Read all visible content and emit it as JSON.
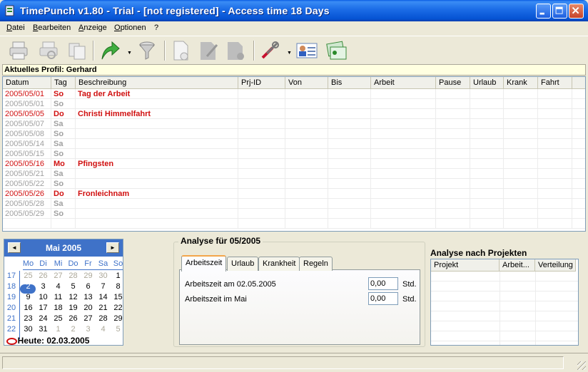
{
  "window": {
    "title": "TimePunch v1.80 - Trial - [not registered] - Access time 18 Days"
  },
  "menu": [
    "Datei",
    "Bearbeiten",
    "Anzeige",
    "Optionen",
    "?"
  ],
  "toolbar": {
    "buttons": [
      "print-icon",
      "print-preview-icon",
      "copy-icon",
      "export-arrow-icon",
      "filter-funnel-icon",
      "new-document-icon",
      "edit-document-icon",
      "delete-document-icon",
      "settings-tools-icon",
      "user-profile-icon",
      "project-card-icon"
    ]
  },
  "profile": {
    "label": "Aktuelles Profil: Gerhard"
  },
  "grid": {
    "columns": [
      "Datum",
      "Tag",
      "Beschreibung",
      "Prj-ID",
      "Von",
      "Bis",
      "Arbeit",
      "Pause",
      "Urlaub",
      "Krank",
      "Fahrt"
    ],
    "rows": [
      {
        "date": "2005/05/01",
        "day": "So",
        "desc": "Tag der Arbeit",
        "holiday": true
      },
      {
        "date": "2005/05/01",
        "day": "So",
        "desc": "",
        "holiday": false
      },
      {
        "date": "2005/05/05",
        "day": "Do",
        "desc": "Christi Himmelfahrt",
        "holiday": true
      },
      {
        "date": "2005/05/07",
        "day": "Sa",
        "desc": "",
        "holiday": false
      },
      {
        "date": "2005/05/08",
        "day": "So",
        "desc": "",
        "holiday": false
      },
      {
        "date": "2005/05/14",
        "day": "Sa",
        "desc": "",
        "holiday": false
      },
      {
        "date": "2005/05/15",
        "day": "So",
        "desc": "",
        "holiday": false
      },
      {
        "date": "2005/05/16",
        "day": "Mo",
        "desc": "Pfingsten",
        "holiday": true
      },
      {
        "date": "2005/05/21",
        "day": "Sa",
        "desc": "",
        "holiday": false
      },
      {
        "date": "2005/05/22",
        "day": "So",
        "desc": "",
        "holiday": false
      },
      {
        "date": "2005/05/26",
        "day": "Do",
        "desc": "Fronleichnam",
        "holiday": true
      },
      {
        "date": "2005/05/28",
        "day": "Sa",
        "desc": "",
        "holiday": false
      },
      {
        "date": "2005/05/29",
        "day": "So",
        "desc": "",
        "holiday": false
      }
    ],
    "colors": {
      "holiday": "#D01010",
      "weekend": "#A0A0A0"
    }
  },
  "calendar": {
    "prev": "◄",
    "next": "►",
    "title": "Mai 2005",
    "weekdays": [
      "Mo",
      "Di",
      "Mi",
      "Do",
      "Fr",
      "Sa",
      "So"
    ],
    "weeks": [
      {
        "wk": "17",
        "days": [
          "25",
          "26",
          "27",
          "28",
          "29",
          "30",
          "1"
        ],
        "muted": [
          true,
          true,
          true,
          true,
          true,
          true,
          false
        ]
      },
      {
        "wk": "18",
        "days": [
          "2",
          "3",
          "4",
          "5",
          "6",
          "7",
          "8"
        ],
        "muted": [
          false,
          false,
          false,
          false,
          false,
          false,
          false
        ]
      },
      {
        "wk": "19",
        "days": [
          "9",
          "10",
          "11",
          "12",
          "13",
          "14",
          "15"
        ],
        "muted": [
          false,
          false,
          false,
          false,
          false,
          false,
          false
        ]
      },
      {
        "wk": "20",
        "days": [
          "16",
          "17",
          "18",
          "19",
          "20",
          "21",
          "22"
        ],
        "muted": [
          false,
          false,
          false,
          false,
          false,
          false,
          false
        ]
      },
      {
        "wk": "21",
        "days": [
          "23",
          "24",
          "25",
          "26",
          "27",
          "28",
          "29"
        ],
        "muted": [
          false,
          false,
          false,
          false,
          false,
          false,
          false
        ]
      },
      {
        "wk": "22",
        "days": [
          "30",
          "31",
          "1",
          "2",
          "3",
          "4",
          "5"
        ],
        "muted": [
          false,
          false,
          true,
          true,
          true,
          true,
          true
        ]
      }
    ],
    "selected": "2",
    "today": "Heute: 02.03.2005"
  },
  "analyse": {
    "title": "Analyse für 05/2005",
    "tabs": [
      "Arbeitszeit",
      "Urlaub",
      "Krankheit",
      "Regeln"
    ],
    "fields": [
      {
        "label": "Arbeitszeit am 02.05.2005",
        "value": "0,00",
        "unit": "Std."
      },
      {
        "label": "Arbeitszeit im Mai",
        "value": "0,00",
        "unit": "Std."
      }
    ]
  },
  "projects": {
    "title": "Analyse nach Projekten",
    "columns": [
      "Projekt",
      "Arbeit...",
      "Verteilung"
    ]
  }
}
